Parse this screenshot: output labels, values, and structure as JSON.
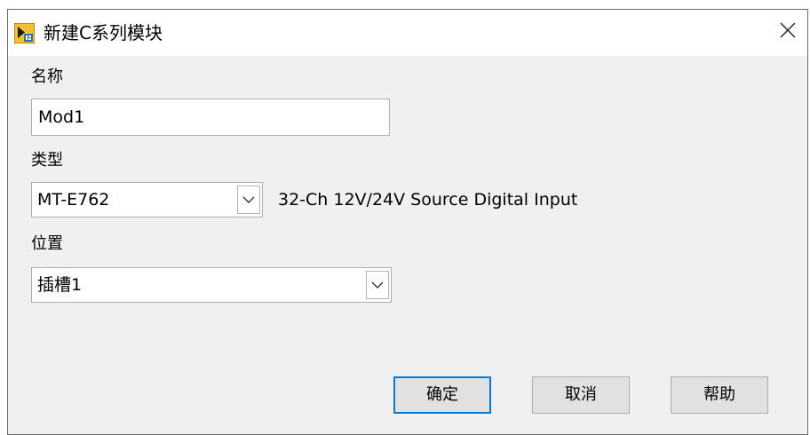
{
  "window": {
    "title": "新建C系列模块",
    "close_glyph": "✕",
    "app_icon": "labview-app-icon"
  },
  "form": {
    "name_label": "名称",
    "name_value": "Mod1",
    "type_label": "类型",
    "type_value": "MT-E762",
    "type_description": "32-Ch 12V/24V Source Digital Input",
    "location_label": "位置",
    "location_value": "插槽1"
  },
  "buttons": {
    "ok": "确定",
    "cancel": "取消",
    "help": "帮助"
  },
  "colors": {
    "focus_border": "#0078d7",
    "dialog_bg": "#f0f0f0",
    "button_bg": "#e1e1e1"
  }
}
